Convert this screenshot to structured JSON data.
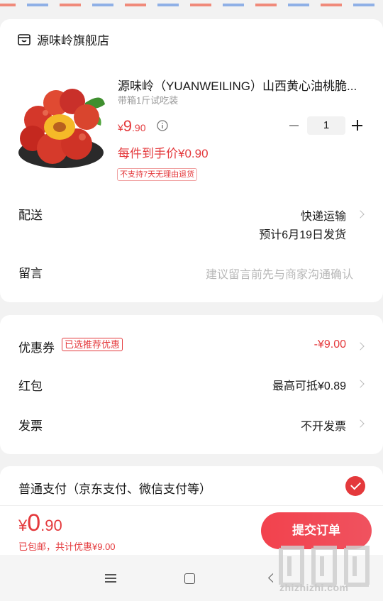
{
  "shop": {
    "name": "源味岭旗舰店",
    "icon": "store-icon"
  },
  "product": {
    "title": "源味岭（YUANWEILING）山西黄心油桃脆...",
    "spec": "带箱1斤试吃装",
    "price_currency": "¥",
    "price_int": "9",
    "price_dec": ".90",
    "quantity": "1",
    "unit_price_text": "每件到手价¥0.90",
    "return_policy": "不支持7天无理由退货"
  },
  "delivery": {
    "label": "配送",
    "method": "快递运输",
    "eta": "预计6月19日发货"
  },
  "message": {
    "label": "留言",
    "placeholder": "建议留言前先与商家沟通确认"
  },
  "discounts": {
    "coupon_label": "优惠券",
    "coupon_badge": "已选推荐优惠",
    "coupon_value": "-¥9.00",
    "redpacket_label": "红包",
    "redpacket_value": "最高可抵¥0.89",
    "invoice_label": "发票",
    "invoice_value": "不开发票"
  },
  "payment": {
    "label": "普通支付（京东支付、微信支付等）",
    "selected": true
  },
  "footer": {
    "total_currency": "¥",
    "total_int": "0",
    "total_dec": ".90",
    "shipping_note": "已包邮，共计优惠¥9.00",
    "submit_label": "提交订单"
  },
  "watermark": {
    "brand": "值",
    "domain": "zhizhizhi.com"
  },
  "colors": {
    "accent": "#e4393c",
    "background": "#f2f2f2",
    "card": "#ffffff"
  }
}
